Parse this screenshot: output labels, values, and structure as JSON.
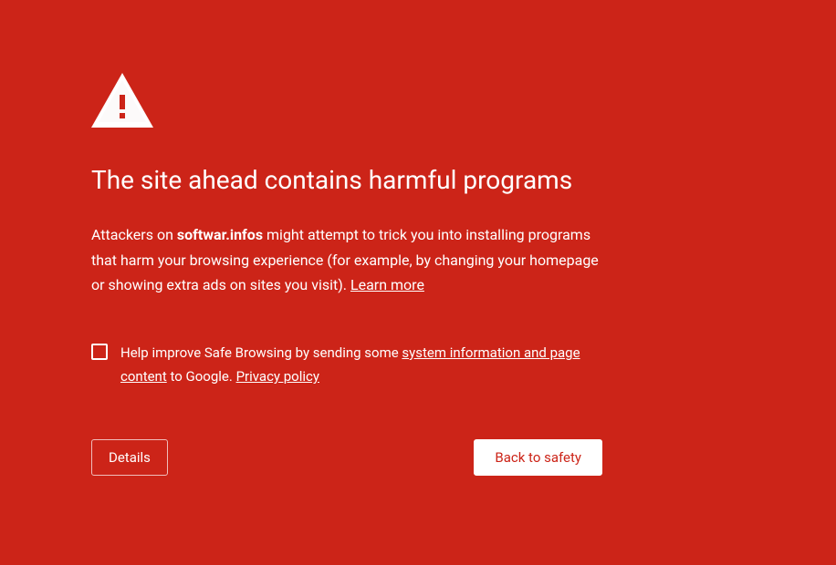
{
  "title": "The site ahead contains harmful programs",
  "description": {
    "prefix": "Attackers on",
    "site": "softwar.infos",
    "body": "might attempt to trick you into installing programs that harm your browsing experience (for example, by changing your homepage or showing extra ads on sites you visit).",
    "learn_more": "Learn more"
  },
  "opt_in": {
    "prefix": "Help improve Safe Browsing by sending some",
    "link1": "system information and page content",
    "middle": "to Google.",
    "privacy": "Privacy policy"
  },
  "buttons": {
    "details": "Details",
    "back_to_safety": "Back to safety"
  }
}
